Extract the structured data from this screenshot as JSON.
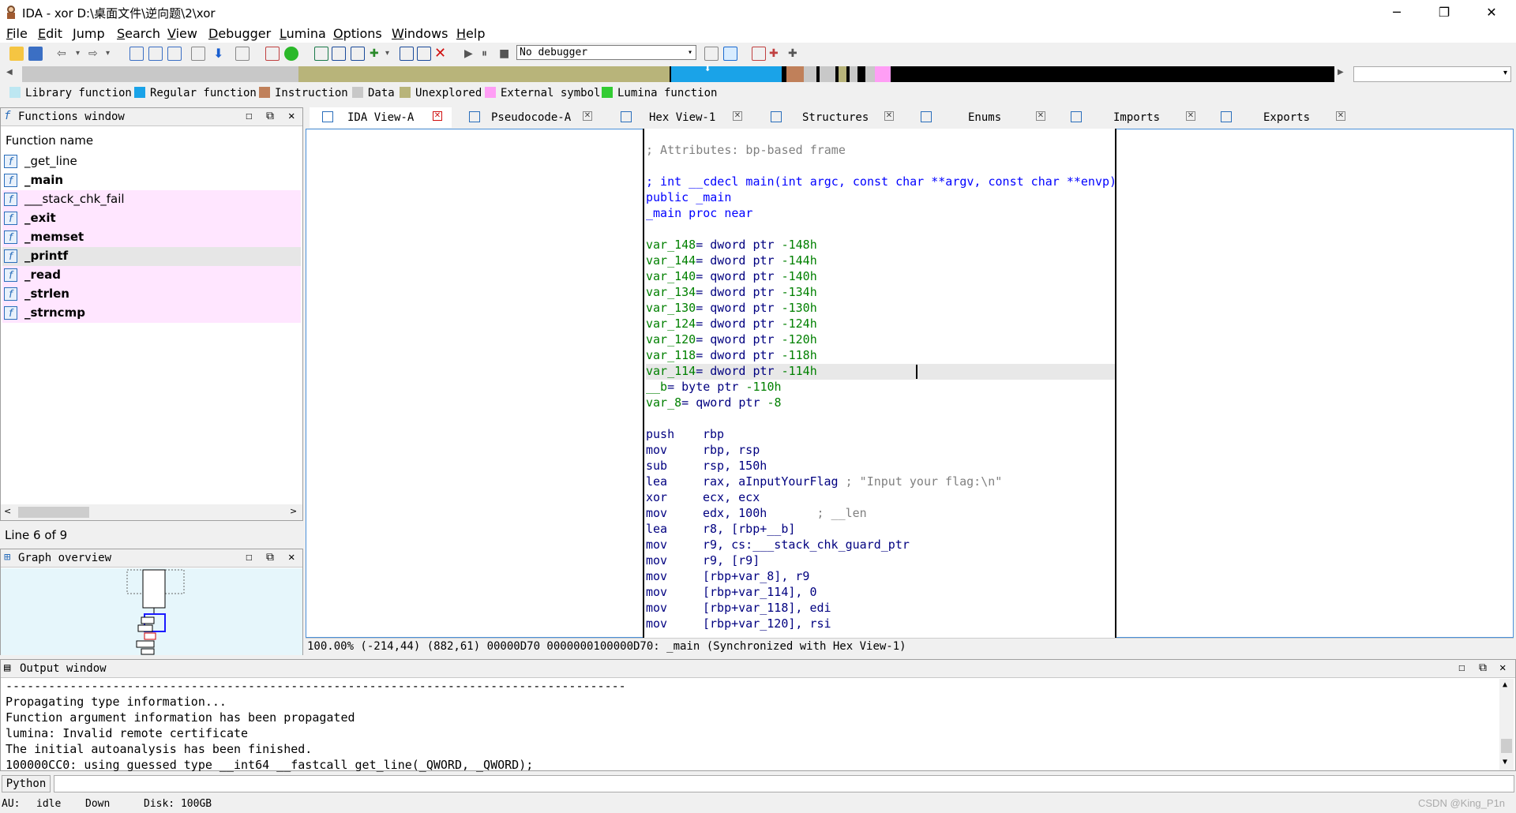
{
  "window": {
    "title": "IDA - xor D:\\桌面文件\\逆向题\\2\\xor",
    "minimize_icon": "minimize-icon",
    "maximize_icon": "restore-icon",
    "close_icon": "close-icon"
  },
  "menu": [
    "File",
    "Edit",
    "Jump",
    "Search",
    "View",
    "Debugger",
    "Lumina",
    "Options",
    "Windows",
    "Help"
  ],
  "toolbar": {
    "debugger_select": "No debugger"
  },
  "nav_colors": {
    "library": "#bde7f2",
    "regular": "#1aa3e8",
    "instruction": "#c0805a",
    "data": "#c8c8c8",
    "unexplored": "#b8b47a",
    "external": "#ff9ef5",
    "lumina": "#33cc33"
  },
  "legend": [
    {
      "label": "Library function",
      "color": "#bde7f2"
    },
    {
      "label": "Regular function",
      "color": "#1aa3e8"
    },
    {
      "label": "Instruction",
      "color": "#c0805a"
    },
    {
      "label": "Data",
      "color": "#c8c8c8"
    },
    {
      "label": "Unexplored",
      "color": "#b8b47a"
    },
    {
      "label": "External symbol",
      "color": "#ff9ef5"
    },
    {
      "label": "Lumina function",
      "color": "#33cc33"
    }
  ],
  "functions_window": {
    "title": "Functions window",
    "column": "Function name",
    "items": [
      {
        "name": "_get_line",
        "bold": false,
        "bg": "#ffffff"
      },
      {
        "name": "_main",
        "bold": true,
        "bg": "#ffffff"
      },
      {
        "name": "___stack_chk_fail",
        "bold": false,
        "bg": "#ffe6ff"
      },
      {
        "name": "_exit",
        "bold": true,
        "bg": "#ffe6ff"
      },
      {
        "name": "_memset",
        "bold": true,
        "bg": "#ffe6ff"
      },
      {
        "name": "_printf",
        "bold": true,
        "bg": "#e6e6e6"
      },
      {
        "name": "_read",
        "bold": true,
        "bg": "#ffe6ff"
      },
      {
        "name": "_strlen",
        "bold": true,
        "bg": "#ffe6ff"
      },
      {
        "name": "_strncmp",
        "bold": true,
        "bg": "#ffe6ff"
      }
    ],
    "line_status": "Line 6 of 9"
  },
  "graph_overview": {
    "title": "Graph overview"
  },
  "tabs": [
    {
      "label": "IDA View-A",
      "icon": "ida-view-icon"
    },
    {
      "label": "Pseudocode-A",
      "icon": "pseudocode-icon"
    },
    {
      "label": "Hex View-1",
      "icon": "hex-view-icon"
    },
    {
      "label": "Structures",
      "icon": "structures-icon"
    },
    {
      "label": "Enums",
      "icon": "enums-icon"
    },
    {
      "label": "Imports",
      "icon": "imports-icon"
    },
    {
      "label": "Exports",
      "icon": "exports-icon"
    }
  ],
  "code": {
    "attributes": "; Attributes: bp-based frame",
    "signature": "; int __cdecl main(int argc, const char **argv, const char **envp)",
    "public": "public _main",
    "proc": "_main proc near",
    "vars": [
      {
        "name": "var_148",
        "type": "dword ptr",
        "off": "-148h"
      },
      {
        "name": "var_144",
        "type": "dword ptr",
        "off": "-144h"
      },
      {
        "name": "var_140",
        "type": "qword ptr",
        "off": "-140h"
      },
      {
        "name": "var_134",
        "type": "dword ptr",
        "off": "-134h"
      },
      {
        "name": "var_130",
        "type": "qword ptr",
        "off": "-130h"
      },
      {
        "name": "var_124",
        "type": "dword ptr",
        "off": "-124h"
      },
      {
        "name": "var_120",
        "type": "qword ptr",
        "off": "-120h"
      },
      {
        "name": "var_118",
        "type": "dword ptr",
        "off": "-118h"
      },
      {
        "name": "var_114",
        "type": "dword ptr",
        "off": "-114h"
      },
      {
        "name": "__b",
        "type": "byte ptr",
        "off": "-110h"
      },
      {
        "name": "var_8",
        "type": "qword ptr",
        "off": "-8"
      }
    ],
    "instructions": [
      {
        "op": "push",
        "args": "rbp",
        "comment": ""
      },
      {
        "op": "mov",
        "args": "rbp, rsp",
        "comment": ""
      },
      {
        "op": "sub",
        "args": "rsp, 150h",
        "comment": ""
      },
      {
        "op": "lea",
        "args": "rax, aInputYourFlag",
        "comment": "; \"Input your flag:\\n\""
      },
      {
        "op": "xor",
        "args": "ecx, ecx",
        "comment": ""
      },
      {
        "op": "mov",
        "args": "edx, 100h",
        "comment": "      ; __len"
      },
      {
        "op": "lea",
        "args": "r8, [rbp+__b]",
        "comment": ""
      },
      {
        "op": "mov",
        "args": "r9, cs:___stack_chk_guard_ptr",
        "comment": ""
      },
      {
        "op": "mov",
        "args": "r9, [r9]",
        "comment": ""
      },
      {
        "op": "mov",
        "args": "[rbp+var_8], r9",
        "comment": ""
      },
      {
        "op": "mov",
        "args": "[rbp+var_114], 0",
        "comment": ""
      },
      {
        "op": "mov",
        "args": "[rbp+var_118], edi",
        "comment": ""
      },
      {
        "op": "mov",
        "args": "[rbp+var_120], rsi",
        "comment": ""
      }
    ]
  },
  "ida_status": "100.00% (-214,44) (882,61) 00000D70 0000000100000D70: _main (Synchronized with Hex View-1)",
  "output_window": {
    "title": "Output window",
    "lines": [
      "---------------------------------------------------------------------------------------",
      "Propagating type information...",
      "Function argument information has been propagated",
      "lumina: Invalid remote certificate",
      "The initial autoanalysis has been finished.",
      "100000CC0: using guessed type __int64 __fastcall get_line(_QWORD, _QWORD);"
    ]
  },
  "python_label": "Python",
  "statusbar": {
    "au_label": "AU:",
    "au_value": "idle",
    "down": "Down",
    "disk": "Disk: 100GB",
    "watermark": "CSDN @King_P1n"
  }
}
